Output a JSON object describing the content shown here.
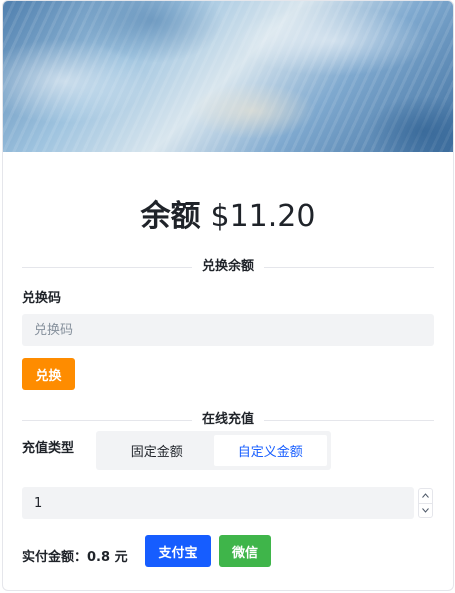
{
  "balance": {
    "label": "余额",
    "value": "$11.20"
  },
  "redeem": {
    "section_title": "兑换余额",
    "code_label": "兑换码",
    "code_placeholder": "兑换码",
    "code_value": "",
    "button_label": "兑换"
  },
  "recharge": {
    "section_title": "在线充值",
    "type_label": "充值类型",
    "types": [
      {
        "label": "固定金额",
        "selected": false
      },
      {
        "label": "自定义金额",
        "selected": true
      }
    ],
    "amount_value": "1",
    "pay_amount_label": "实付金额：",
    "pay_amount_value": "0.8 元",
    "methods": [
      {
        "label": "支付宝",
        "color": "#165dff"
      },
      {
        "label": "微信",
        "color": "#3fb54a"
      }
    ]
  },
  "colors": {
    "accent": "#165dff",
    "redeem_button": "#fe8c00",
    "wechat": "#3fb54a"
  },
  "icons": {
    "stepper_up": "chevron-up-icon",
    "stepper_down": "chevron-down-icon"
  }
}
